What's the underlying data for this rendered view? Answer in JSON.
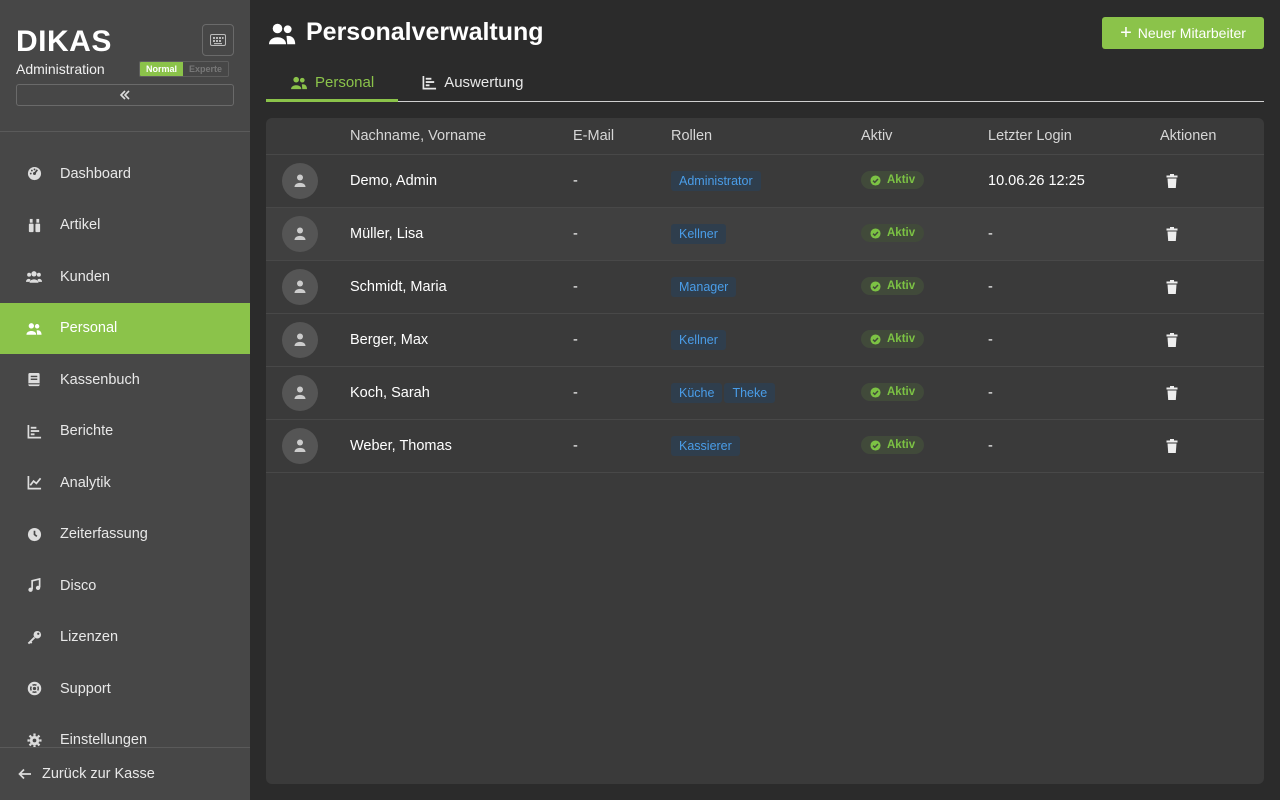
{
  "sidebar": {
    "logo": "DIKAS",
    "subtitle": "Administration",
    "mode": {
      "normal": "Normal",
      "expert": "Experte"
    },
    "items": [
      {
        "label": "Dashboard",
        "icon": "dashboard-icon"
      },
      {
        "label": "Artikel",
        "icon": "articles-icon"
      },
      {
        "label": "Kunden",
        "icon": "customers-icon"
      },
      {
        "label": "Personal",
        "icon": "staff-icon",
        "active": true
      },
      {
        "label": "Kassenbuch",
        "icon": "cashbook-icon"
      },
      {
        "label": "Berichte",
        "icon": "reports-icon"
      },
      {
        "label": "Analytik",
        "icon": "analytics-icon"
      },
      {
        "label": "Zeiterfassung",
        "icon": "clock-icon"
      },
      {
        "label": "Disco",
        "icon": "music-icon"
      },
      {
        "label": "Lizenzen",
        "icon": "key-icon"
      },
      {
        "label": "Support",
        "icon": "lifebuoy-icon"
      },
      {
        "label": "Einstellungen",
        "icon": "gear-icon"
      }
    ],
    "back_label": "Zurück zur Kasse"
  },
  "header": {
    "title": "Personalverwaltung",
    "new_button": "Neuer Mitarbeiter"
  },
  "tabs": [
    {
      "label": "Personal",
      "active": true
    },
    {
      "label": "Auswertung",
      "active": false
    }
  ],
  "table": {
    "columns": [
      "Nachname, Vorname",
      "E-Mail",
      "Rollen",
      "Aktiv",
      "Letzter Login",
      "Aktionen"
    ],
    "rows": [
      {
        "name": "Demo, Admin",
        "email": "-",
        "roles": [
          "Administrator"
        ],
        "status": "Aktiv",
        "last_login": "10.06.26 12:25"
      },
      {
        "name": "Müller, Lisa",
        "email": "-",
        "roles": [
          "Kellner"
        ],
        "status": "Aktiv",
        "last_login": "-"
      },
      {
        "name": "Schmidt, Maria",
        "email": "-",
        "roles": [
          "Manager"
        ],
        "status": "Aktiv",
        "last_login": "-"
      },
      {
        "name": "Berger, Max",
        "email": "-",
        "roles": [
          "Kellner"
        ],
        "status": "Aktiv",
        "last_login": "-"
      },
      {
        "name": "Koch, Sarah",
        "email": "-",
        "roles": [
          "Küche",
          "Theke"
        ],
        "status": "Aktiv",
        "last_login": "-"
      },
      {
        "name": "Weber, Thomas",
        "email": "-",
        "roles": [
          "Kassierer"
        ],
        "status": "Aktiv",
        "last_login": "-"
      }
    ]
  },
  "colors": {
    "accent": "#8bc34a",
    "role_text": "#4a9de8",
    "status_text": "#7cc244"
  }
}
